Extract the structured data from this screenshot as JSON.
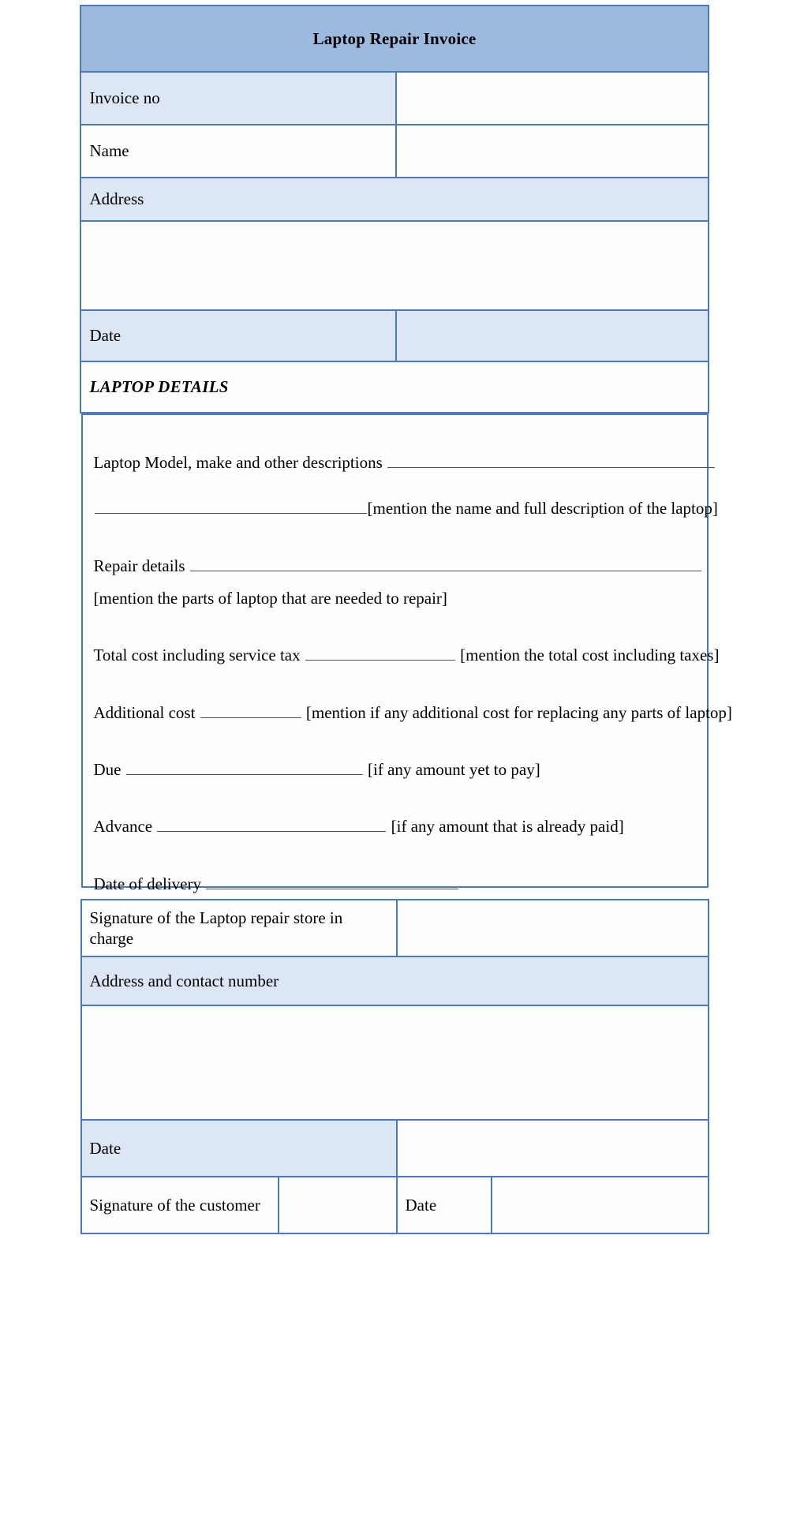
{
  "document": {
    "title": "Laptop Repair Invoice"
  },
  "colors": {
    "banner": "#9cb9de",
    "shade": "#dce6f4",
    "border": "#4a79bf",
    "rule": "#4d4d4d"
  },
  "top_table": {
    "rows": [
      {
        "label": "Invoice no",
        "value": ""
      },
      {
        "label": "Name",
        "value": ""
      },
      {
        "label": "Address",
        "value": ""
      },
      {
        "label": "",
        "value": ""
      },
      {
        "label": "Date",
        "value": ""
      }
    ]
  },
  "section": {
    "heading": "LAPTOP DETAILS"
  },
  "details": {
    "model_label": "Laptop Model, make and other descriptions",
    "model_hint": "[mention the name and full description of the laptop]",
    "repair_label": "Repair details",
    "repair_hint": "[mention the parts of laptop that are needed to repair]",
    "total_label": "Total cost including service tax",
    "total_hint": "[mention the total cost including taxes]",
    "additional_label": "Additional cost",
    "additional_hint": "[mention if any additional cost for replacing any parts of laptop]",
    "due_label": "Due",
    "due_hint": "[if any amount yet to pay]",
    "advance_label": "Advance",
    "advance_hint": "[if any amount that is already paid]",
    "delivery_label": "Date of delivery"
  },
  "bottom_table": {
    "store_signature_label": "Signature of the Laptop repair store in charge",
    "store_signature_value": "",
    "address_contact_label": "Address and contact number",
    "address_contact_value": "",
    "date_label": "Date",
    "date_value": "",
    "customer_signature_label": "Signature of the customer",
    "customer_signature_value": "",
    "customer_date_label": "Date",
    "customer_date_value": ""
  }
}
